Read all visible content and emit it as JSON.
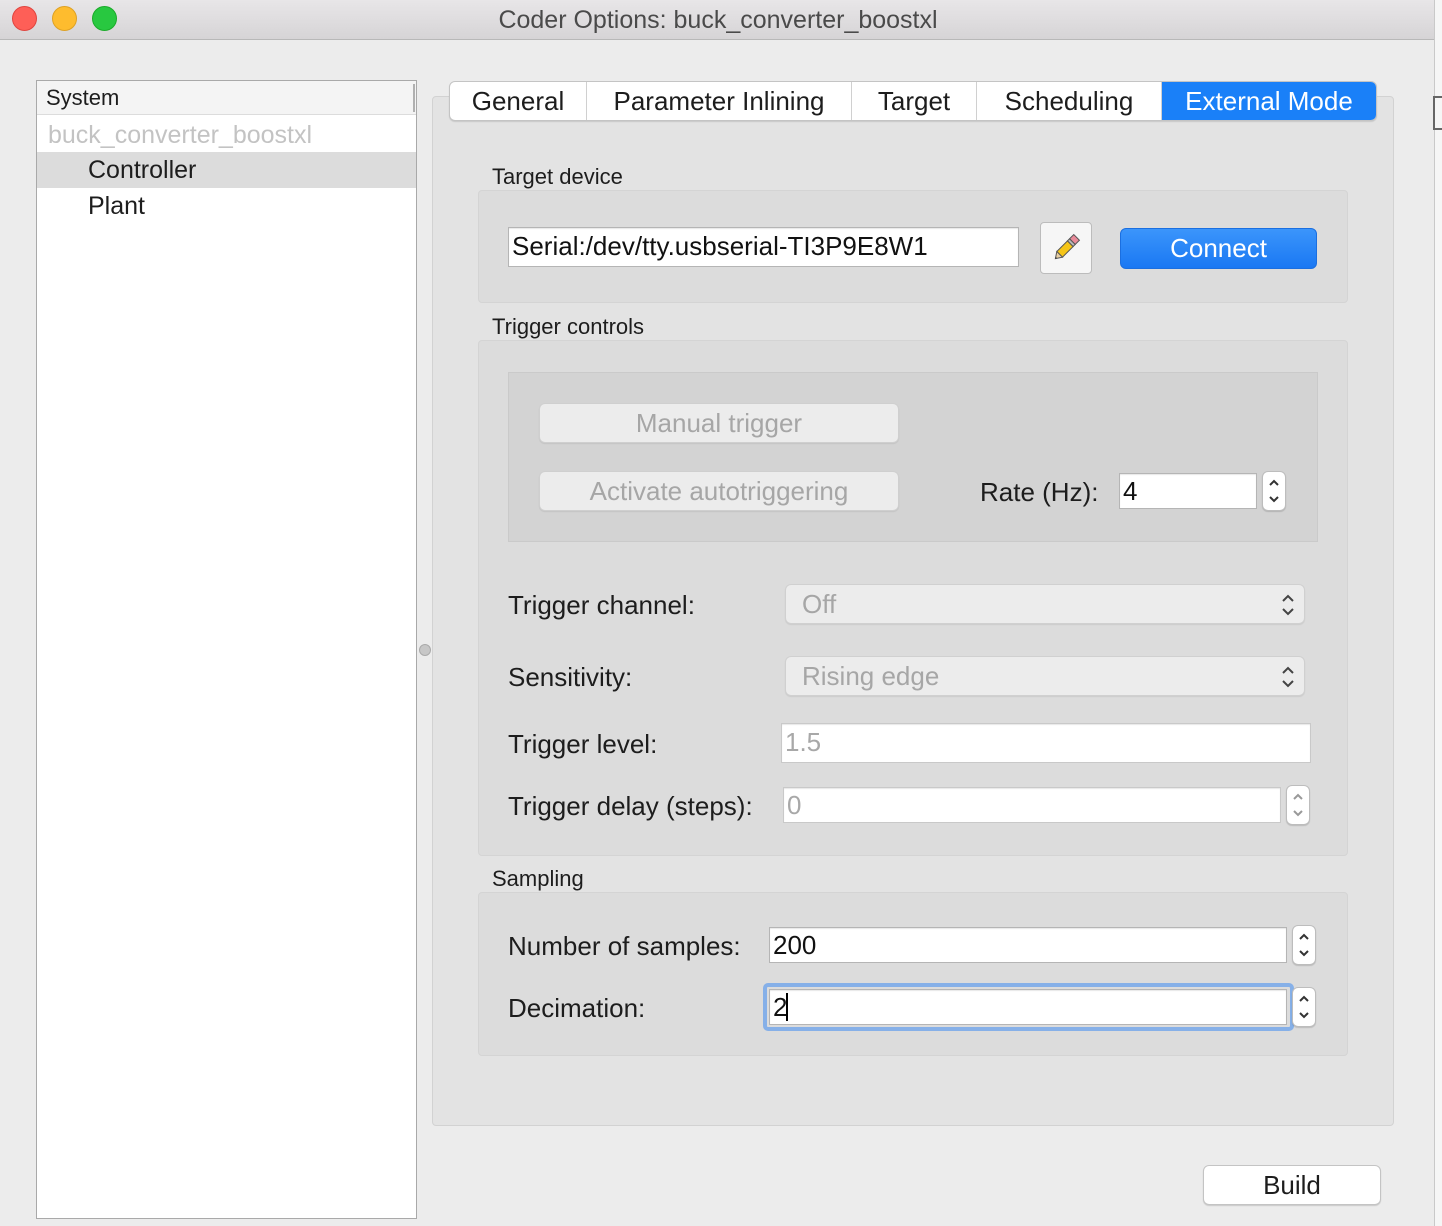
{
  "window": {
    "title": "Coder Options: buck_converter_boostxl",
    "traffic_lights": {
      "close": "#fe5f57",
      "minimize": "#febc2e",
      "zoom": "#28c840"
    }
  },
  "tree": {
    "header": "System",
    "items": [
      {
        "label": "buck_converter_boostxl",
        "level": 0,
        "state": "dimmed"
      },
      {
        "label": "Controller",
        "level": 1,
        "state": "selected"
      },
      {
        "label": "Plant",
        "level": 1,
        "state": "normal"
      }
    ]
  },
  "tabs": [
    {
      "label": "General",
      "active": false
    },
    {
      "label": "Parameter Inlining",
      "active": false
    },
    {
      "label": "Target",
      "active": false
    },
    {
      "label": "Scheduling",
      "active": false
    },
    {
      "label": "External Mode",
      "active": true
    }
  ],
  "target_device": {
    "section_label": "Target device",
    "device_value": "Serial:/dev/tty.usbserial-TI3P9E8W1",
    "edit_icon": "pencil-icon",
    "connect_label": "Connect"
  },
  "trigger_controls": {
    "section_label": "Trigger controls",
    "manual_trigger_label": "Manual trigger",
    "autotrigger_label": "Activate autotriggering",
    "rate_label": "Rate (Hz):",
    "rate_value": "4",
    "trigger_channel_label": "Trigger channel:",
    "trigger_channel_value": "Off",
    "sensitivity_label": "Sensitivity:",
    "sensitivity_value": "Rising edge",
    "trigger_level_label": "Trigger level:",
    "trigger_level_value": "1.5",
    "trigger_delay_label": "Trigger delay (steps):",
    "trigger_delay_value": "0"
  },
  "sampling": {
    "section_label": "Sampling",
    "num_samples_label": "Number of samples:",
    "num_samples_value": "200",
    "decimation_label": "Decimation:",
    "decimation_value": "2"
  },
  "footer": {
    "build_label": "Build"
  },
  "colors": {
    "accent": "#1a80f8",
    "focus_ring": "#86b0e8"
  }
}
